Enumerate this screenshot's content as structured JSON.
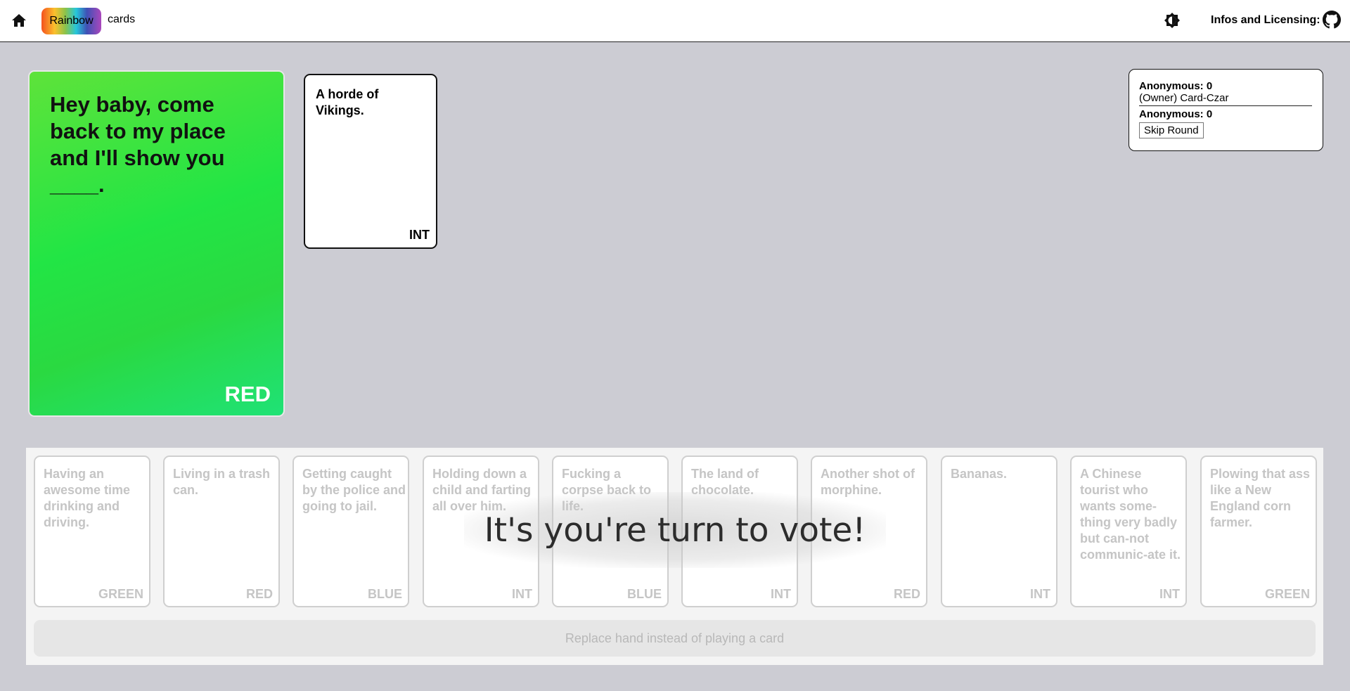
{
  "header": {
    "home_icon": "home-icon",
    "brand": "Rainbow",
    "brand_suffix": "cards",
    "theme_icon": "brightness-icon",
    "info_label": "Infos and Licensing:",
    "github_icon": "github-icon"
  },
  "black_card": {
    "text": "Hey baby, come back to my place and I'll show you ____.",
    "color_tag": "RED",
    "accent": "#22e545"
  },
  "played_card": {
    "text": "A horde of Vikings.",
    "tag": "INT"
  },
  "scoreboard": {
    "players": [
      {
        "name_score": "Anonymous: 0",
        "role": "(Owner) Card-Czar"
      },
      {
        "name_score": "Anonymous: 0"
      }
    ],
    "skip_label": "Skip Round"
  },
  "hand": {
    "cards": [
      {
        "text": "Having an awesome time drinking and driving.",
        "tag": "GREEN"
      },
      {
        "text": "Living in a trash can.",
        "tag": "RED"
      },
      {
        "text": "Getting caught by the police and going to jail.",
        "tag": "BLUE"
      },
      {
        "text": "Holding down a child and farting all over him.",
        "tag": "INT"
      },
      {
        "text": "Fucking a corpse back to life.",
        "tag": "BLUE"
      },
      {
        "text": "The land of chocolate.",
        "tag": "INT"
      },
      {
        "text": "Another shot of morphine.",
        "tag": "RED"
      },
      {
        "text": "Bananas.",
        "tag": "INT"
      },
      {
        "text": "A Chinese tourist who wants some-thing very badly but can-not communic-ate it.",
        "tag": "INT"
      },
      {
        "text": "Plowing that ass like a New England corn farmer.",
        "tag": "GREEN"
      }
    ],
    "vote_message": "It's you're turn to vote!",
    "replace_label": "Replace hand instead of playing a card"
  }
}
